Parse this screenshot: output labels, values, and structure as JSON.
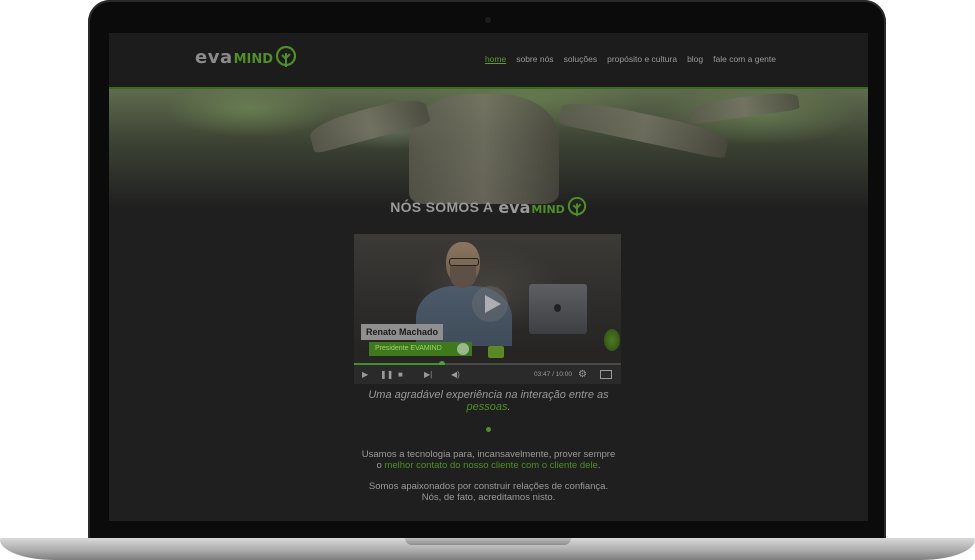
{
  "logo": {
    "eva": "eva",
    "mind": "MIND"
  },
  "nav": {
    "items": [
      {
        "label": "home",
        "active": true
      },
      {
        "label": "sobre nós"
      },
      {
        "label": "soluções"
      },
      {
        "label": "propósito e cultura"
      },
      {
        "label": "blog"
      },
      {
        "label": "fale com a gente"
      }
    ]
  },
  "headline": {
    "prefix": "NÓS SOMOS A",
    "eva": "eva",
    "mind": "MIND"
  },
  "video": {
    "name": "Renato Machado",
    "role": "Presidente EVAMIND",
    "time": "03:47 / 10:00",
    "progress": 0.33
  },
  "tagline": {
    "line1": "Uma agradável experiência na interação entre as",
    "line2_green": "pessoas",
    "line2_end": "."
  },
  "para1": {
    "line1": "Usamos a tecnologia para, incansavelmente, prover sempre",
    "line2_start": "o ",
    "line2_green": "melhor contato do nosso cliente com o cliente dele",
    "line2_end": "."
  },
  "para2": {
    "line1": "Somos apaixonados por construir relações de confiança.",
    "line2": "Nós, de fato, acreditamos nisto."
  },
  "colors": {
    "accent": "#4f8f25",
    "background": "#1f1f1f"
  }
}
